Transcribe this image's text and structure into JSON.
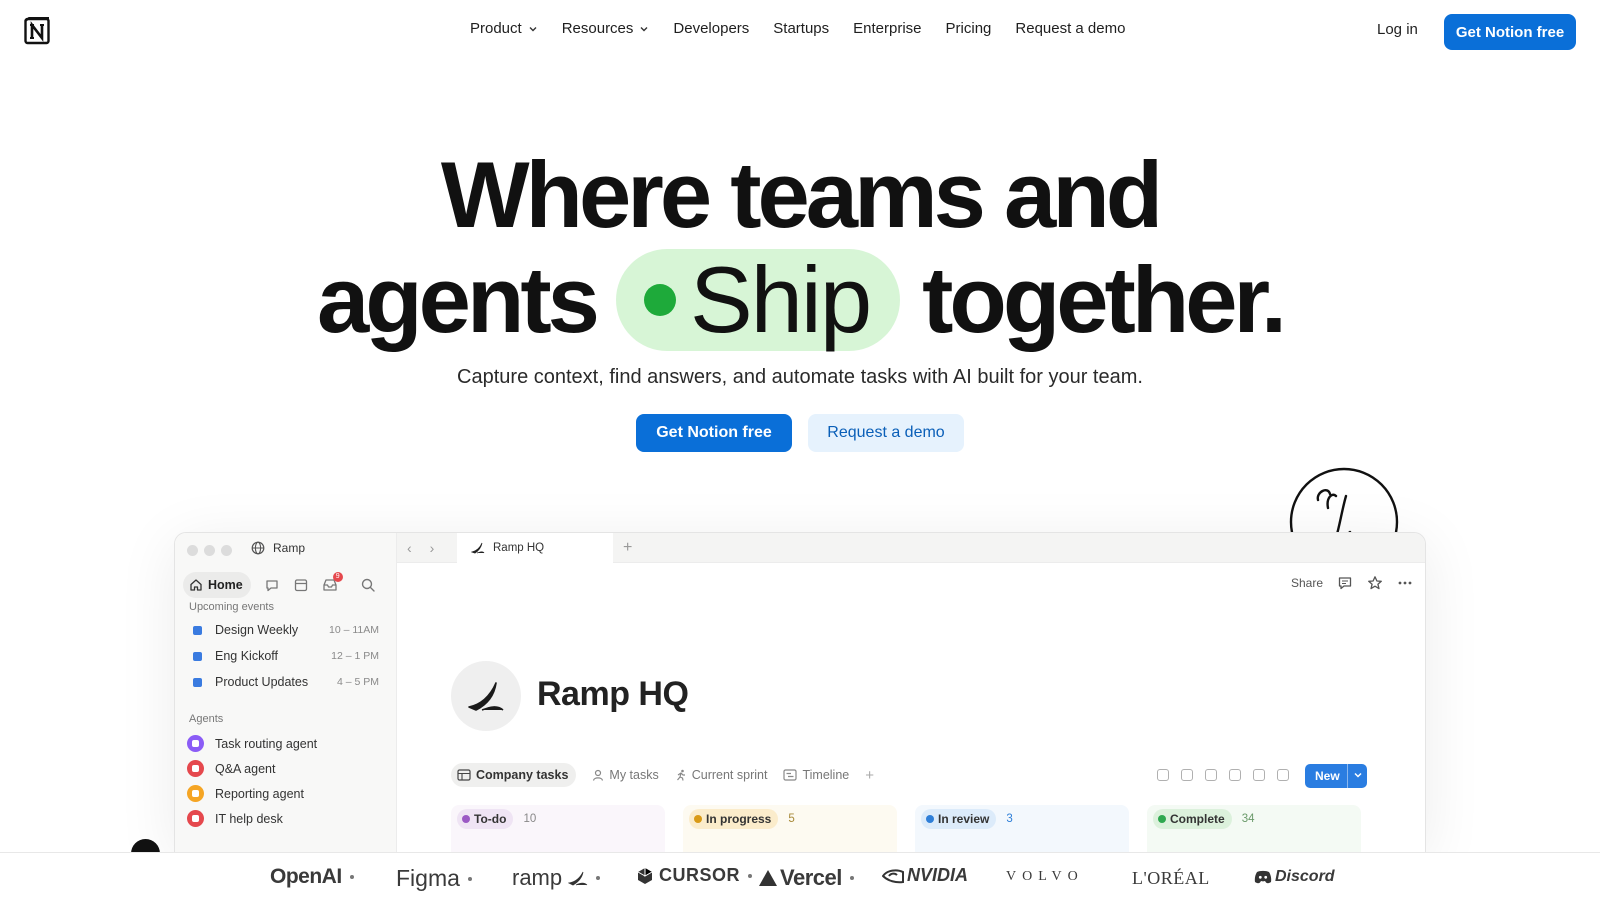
{
  "nav": {
    "links": [
      {
        "label": "Product",
        "dropdown": true
      },
      {
        "label": "Resources",
        "dropdown": true
      },
      {
        "label": "Developers",
        "dropdown": false
      },
      {
        "label": "Startups",
        "dropdown": false
      },
      {
        "label": "Enterprise",
        "dropdown": false
      },
      {
        "label": "Pricing",
        "dropdown": false
      },
      {
        "label": "Request a demo",
        "dropdown": false
      }
    ],
    "login_label": "Log in",
    "cta_label": "Get Notion free",
    "logo_icon": "notion-logo-icon"
  },
  "hero": {
    "line1": "Where teams and",
    "line2_prefix": "agents",
    "pill_word": "Ship",
    "line2_suffix": "together.",
    "subtitle": "Capture context, find answers, and automate tasks with AI built for your team.",
    "primary_cta": "Get Notion free",
    "secondary_cta": "Request a demo"
  },
  "app": {
    "workspace": "Ramp",
    "home_label": "Home",
    "inbox_badge": "9",
    "tab_title": "Ramp HQ",
    "share_label": "Share",
    "upcoming_title": "Upcoming events",
    "events": [
      {
        "name": "Design Weekly",
        "time": "10 – 11AM"
      },
      {
        "name": "Eng Kickoff",
        "time": "12 – 1 PM"
      },
      {
        "name": "Product Updates",
        "time": "4 – 5 PM"
      }
    ],
    "agents_title": "Agents",
    "agents": [
      {
        "name": "Task routing agent",
        "color": "#8b5cf6"
      },
      {
        "name": "Q&A agent",
        "color": "#e5484d"
      },
      {
        "name": "Reporting agent",
        "color": "#f5a524"
      },
      {
        "name": "IT help desk",
        "color": "#e5484d"
      }
    ],
    "page_title": "Ramp HQ",
    "views": [
      {
        "label": "Company tasks",
        "active": true
      },
      {
        "label": "My tasks",
        "active": false
      },
      {
        "label": "Current sprint",
        "active": false
      },
      {
        "label": "Timeline",
        "active": false
      }
    ],
    "new_label": "New",
    "columns": [
      {
        "label": "To-do",
        "count": "10",
        "bg": "#faf6fb",
        "pill": "#efe4f4",
        "dot": "#9b59c4",
        "count_color": "#888"
      },
      {
        "label": "In progress",
        "count": "5",
        "bg": "#fdfaf1",
        "pill": "#fbeccb",
        "dot": "#d99a16",
        "count_color": "#a88a3a"
      },
      {
        "label": "In review",
        "count": "3",
        "bg": "#f3f8fd",
        "pill": "#dcebfa",
        "dot": "#2f7fd8",
        "count_color": "#2f7fd8"
      },
      {
        "label": "Complete",
        "count": "34",
        "bg": "#f4faf4",
        "pill": "#dcf1dc",
        "dot": "#2fa84f",
        "count_color": "#6a9a6a"
      }
    ]
  },
  "logos": [
    {
      "name": "OpenAI",
      "sep": true
    },
    {
      "name": "Figma",
      "sep": true
    },
    {
      "name": "ramp",
      "sep": true
    },
    {
      "name": "CURSOR",
      "sep": true
    },
    {
      "name": "Vercel",
      "sep": true
    },
    {
      "name": "NVIDIA",
      "sep": false
    },
    {
      "name": "VOLVO",
      "sep": false
    },
    {
      "name": "L'ORÉAL",
      "sep": false
    },
    {
      "name": "Discord",
      "sep": false
    }
  ],
  "colors": {
    "accent": "#0a6fd8",
    "ship_pill": "#d7f5d6",
    "ship_dot": "#1eaa3a"
  }
}
